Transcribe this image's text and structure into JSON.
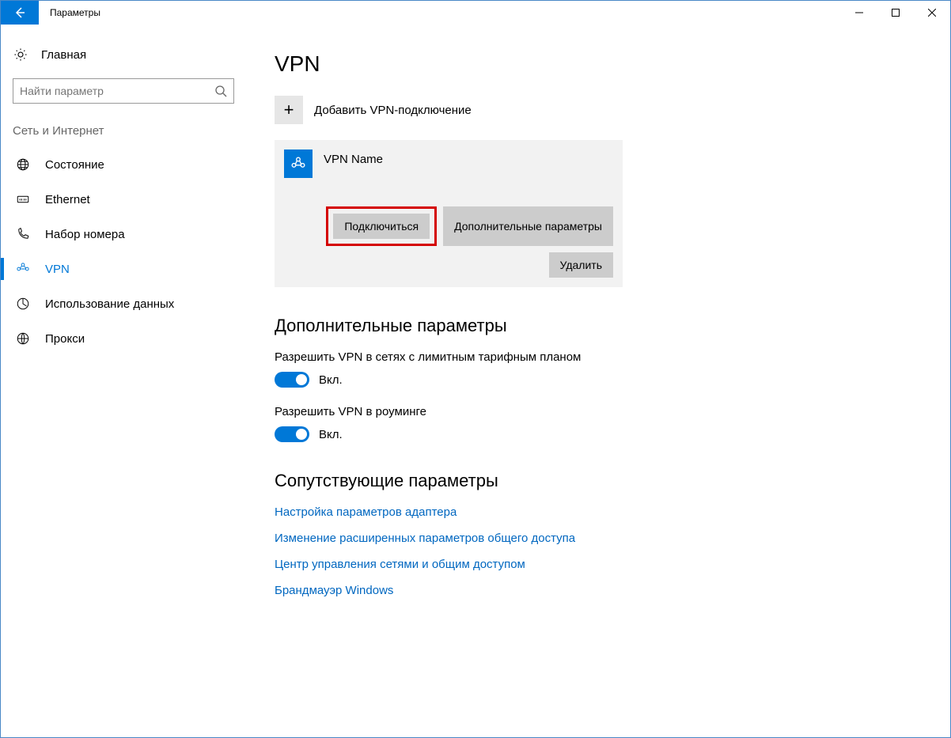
{
  "window": {
    "title": "Параметры"
  },
  "sidebar": {
    "home": "Главная",
    "search_placeholder": "Найти параметр",
    "section": "Сеть и Интернет",
    "items": [
      {
        "label": "Состояние"
      },
      {
        "label": "Ethernet"
      },
      {
        "label": "Набор номера"
      },
      {
        "label": "VPN"
      },
      {
        "label": "Использование данных"
      },
      {
        "label": "Прокси"
      }
    ]
  },
  "content": {
    "title": "VPN",
    "add_label": "Добавить VPN-подключение",
    "vpn": {
      "name": "VPN Name",
      "connect": "Подключиться",
      "advanced": "Дополнительные параметры",
      "delete": "Удалить"
    },
    "advanced_section": "Дополнительные параметры",
    "toggles": [
      {
        "label": "Разрешить VPN в сетях с лимитным тарифным планом",
        "state": "Вкл."
      },
      {
        "label": "Разрешить VPN в роуминге",
        "state": "Вкл."
      }
    ],
    "related_section": "Сопутствующие параметры",
    "links": [
      "Настройка параметров адаптера",
      "Изменение расширенных параметров общего доступа",
      "Центр управления сетями и общим доступом",
      "Брандмауэр Windows"
    ]
  }
}
